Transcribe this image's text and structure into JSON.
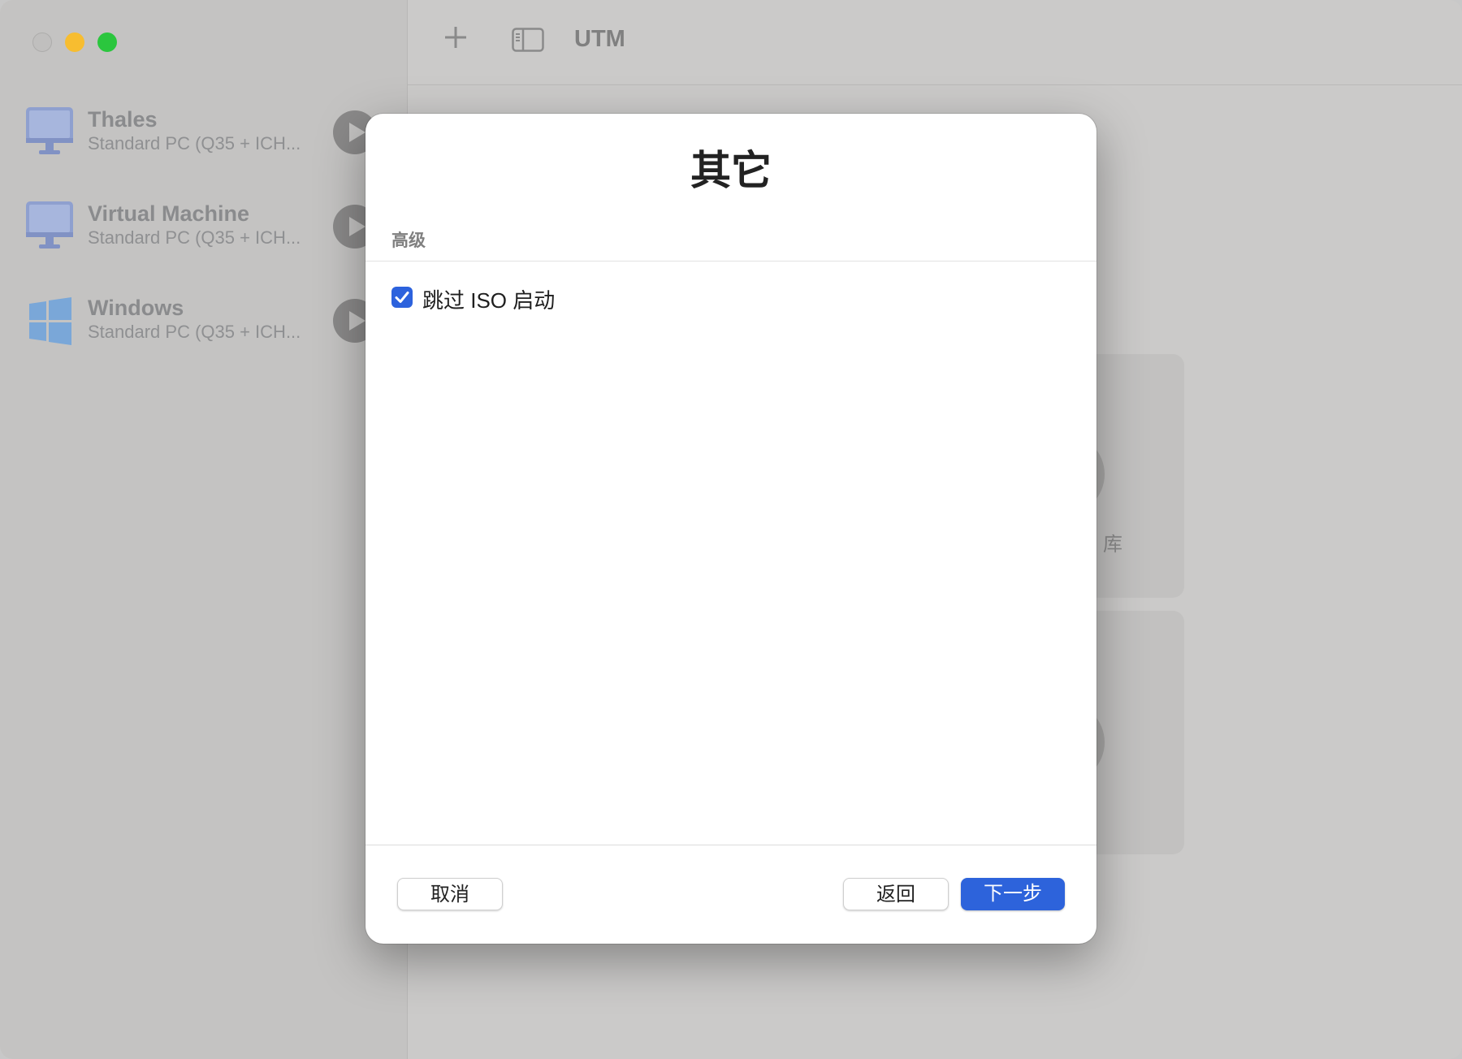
{
  "window": {
    "title": "UTM",
    "colors": {
      "accent": "#2c62dd",
      "traffic_minimize": "#f7bd30",
      "traffic_maximize": "#2bc63e"
    }
  },
  "sidebar": {
    "vms": [
      {
        "name": "Thales",
        "subtitle": "Standard PC (Q35 + ICH...",
        "icon": "monitor-icon"
      },
      {
        "name": "Virtual Machine",
        "subtitle": "Standard PC (Q35 + ICH...",
        "icon": "monitor-icon"
      },
      {
        "name": "Windows",
        "subtitle": "Standard PC (Q35 + ICH...",
        "icon": "windows-logo-icon"
      }
    ]
  },
  "toolbar": {
    "add_icon": "plus-icon",
    "sidebar_toggle_icon": "sidebar-icon"
  },
  "background": {
    "card_text": "库"
  },
  "dialog": {
    "title": "其它",
    "section_header": "高级",
    "skip_iso_label": "跳过 ISO 启动",
    "skip_iso_checked": true,
    "cancel_label": "取消",
    "back_label": "返回",
    "next_label": "下一步"
  }
}
